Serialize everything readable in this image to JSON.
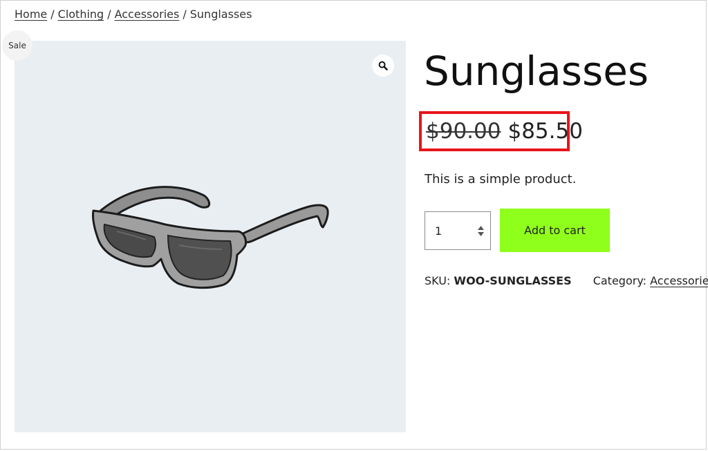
{
  "breadcrumb": {
    "items": [
      "Home",
      "Clothing",
      "Accessories"
    ],
    "separator": "/",
    "current": "Sunglasses"
  },
  "gallery": {
    "sale_badge": "Sale",
    "zoom_icon": "magnifier-icon",
    "background_color": "#e9eef3"
  },
  "product": {
    "title": "Sunglasses",
    "regular_price": "$90.00",
    "sale_price": "$85.50",
    "short_description": "This is a simple product.",
    "quantity": "1",
    "add_to_cart_label": "Add to cart",
    "add_to_cart_color": "#8fff1c",
    "highlight_color": "#e8141b",
    "sku_label": "SKU:",
    "sku_value": "WOO-SUNGLASSES",
    "category_label": "Category:",
    "category_value": "Accessories"
  }
}
